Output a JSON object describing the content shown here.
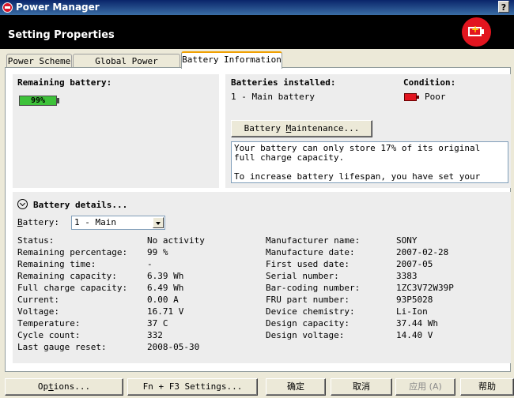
{
  "window": {
    "title": "Power Manager",
    "help_label": "?"
  },
  "header": {
    "title": "Setting Properties"
  },
  "tabs": [
    {
      "label": "Power Scheme"
    },
    {
      "label": "Global Power Settings"
    },
    {
      "label": "Battery Information",
      "active": true
    }
  ],
  "remaining": {
    "label": "Remaining battery:",
    "percent_text": "99%",
    "percent": 99
  },
  "installed": {
    "label": "Batteries installed:",
    "value": "1 - Main battery"
  },
  "condition": {
    "label": "Condition:",
    "value": "Poor"
  },
  "maintenance": {
    "pre": "Battery ",
    "u": "M",
    "post": "aintenance..."
  },
  "message": {
    "line1": "Your battery can only store 17% of its original full charge capacity.",
    "line2": "To increase battery lifespan, you have set your battery"
  },
  "details": {
    "title": "Battery details...",
    "battery_label_pre": "",
    "battery_label_u": "B",
    "battery_label_post": "attery:",
    "battery_selected": "1 - Main",
    "left": [
      {
        "label": "Status:",
        "value": "No activity"
      },
      {
        "label": "Remaining percentage:",
        "value": "99 %"
      },
      {
        "label": "Remaining time:",
        "value": "-"
      },
      {
        "label": "Remaining capacity:",
        "value": "6.39 Wh"
      },
      {
        "label": "Full charge capacity:",
        "value": "6.49 Wh"
      },
      {
        "label": "Current:",
        "value": "0.00 A"
      },
      {
        "label": "Voltage:",
        "value": "16.71 V"
      },
      {
        "label": "Temperature:",
        "value": "37 C"
      },
      {
        "label": "Cycle count:",
        "value": "332"
      },
      {
        "label": "Last gauge reset:",
        "value": "2008-05-30"
      }
    ],
    "right": [
      {
        "label": "Manufacturer name:",
        "value": "SONY"
      },
      {
        "label": "Manufacture date:",
        "value": "2007-02-28"
      },
      {
        "label": "First used date:",
        "value": "2007-05"
      },
      {
        "label": "Serial number:",
        "value": "3383"
      },
      {
        "label": "Bar-coding number:",
        "value": "1ZC3V72W39P"
      },
      {
        "label": "FRU part number:",
        "value": "93P5028"
      },
      {
        "label": "Device chemistry:",
        "value": "Li-Ion"
      },
      {
        "label": "Design capacity:",
        "value": "37.44 Wh"
      },
      {
        "label": "Design voltage:",
        "value": "14.40 V"
      }
    ]
  },
  "footer": {
    "options_pre": "Op",
    "options_u": "t",
    "options_post": "ions...",
    "fn_label": "Fn + F3 Settings...",
    "ok": "确定",
    "cancel": "取消",
    "apply": "应用 (A)",
    "help": "帮助"
  },
  "colors": {
    "accent_tab": "#f0a000",
    "battery_fill": "#3ec23a",
    "logo_red": "#e2151f"
  }
}
